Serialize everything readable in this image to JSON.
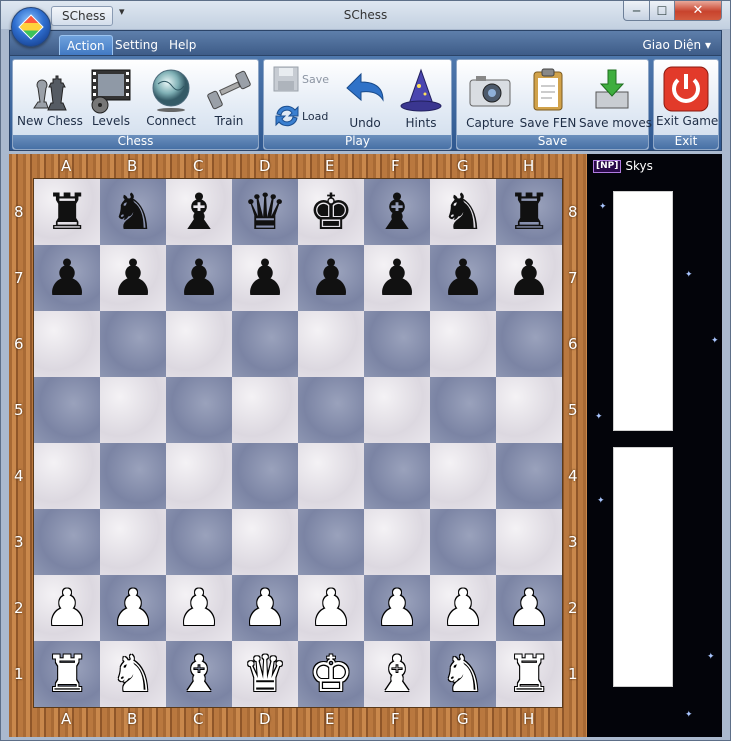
{
  "app": {
    "quick_access_label": "SChess",
    "quick_access_dropdown": "▾",
    "title": "SChess",
    "min_glyph": "─",
    "max_glyph": "☐",
    "close_glyph": "✕"
  },
  "menu": {
    "tabs": [
      {
        "label": "Action"
      },
      {
        "label": "Setting"
      },
      {
        "label": "Help"
      }
    ],
    "theme_label": "Giao Diện ▾"
  },
  "ribbon": {
    "groups": [
      {
        "label": "Chess",
        "buttons": [
          {
            "label": "New Chess",
            "icon": "chess-pieces-icon"
          },
          {
            "label": "Levels",
            "icon": "film-reel-icon"
          },
          {
            "label": "Connect",
            "icon": "globe-icon"
          },
          {
            "label": "Train",
            "icon": "dumbbell-icon"
          }
        ]
      },
      {
        "label": "Play",
        "buttons": [
          {
            "label": "Save",
            "icon": "save-disk-icon",
            "disabled": true
          },
          {
            "label": "Load",
            "icon": "refresh-arrows-icon"
          },
          {
            "label": "Undo",
            "icon": "undo-arrow-icon"
          },
          {
            "label": "Hints",
            "icon": "wizard-hat-icon"
          }
        ]
      },
      {
        "label": "Save",
        "buttons": [
          {
            "label": "Capture",
            "icon": "camera-icon"
          },
          {
            "label": "Save FEN",
            "icon": "clipboard-icon"
          },
          {
            "label": "Save moves",
            "icon": "download-icon"
          }
        ]
      },
      {
        "label": "Exit",
        "buttons": [
          {
            "label": "Exit Game",
            "icon": "power-icon"
          }
        ]
      }
    ]
  },
  "board": {
    "files": [
      "A",
      "B",
      "C",
      "D",
      "E",
      "F",
      "G",
      "H"
    ],
    "ranks": [
      "8",
      "7",
      "6",
      "5",
      "4",
      "3",
      "2",
      "1"
    ],
    "rows": [
      [
        "br",
        "bn",
        "bb",
        "bq",
        "bk",
        "bb",
        "bn",
        "br"
      ],
      [
        "bp",
        "bp",
        "bp",
        "bp",
        "bp",
        "bp",
        "bp",
        "bp"
      ],
      [
        "",
        "",
        "",
        "",
        "",
        "",
        "",
        ""
      ],
      [
        "",
        "",
        "",
        "",
        "",
        "",
        "",
        ""
      ],
      [
        "",
        "",
        "",
        "",
        "",
        "",
        "",
        ""
      ],
      [
        "",
        "",
        "",
        "",
        "",
        "",
        "",
        ""
      ],
      [
        "wp",
        "wp",
        "wp",
        "wp",
        "wp",
        "wp",
        "wp",
        "wp"
      ],
      [
        "wr",
        "wn",
        "wb",
        "wq",
        "wk",
        "wb",
        "wn",
        "wr"
      ]
    ]
  },
  "side_panel": {
    "player_badge": "[NP]",
    "player_name": "Skys"
  },
  "colors": {
    "ribbon_blue": "#2f5890",
    "close_red": "#c8432d",
    "board_wood": "#b9783f",
    "light_square": "#e6e3ea",
    "dark_square": "#8a93b0",
    "space_bg": "#03040a"
  }
}
